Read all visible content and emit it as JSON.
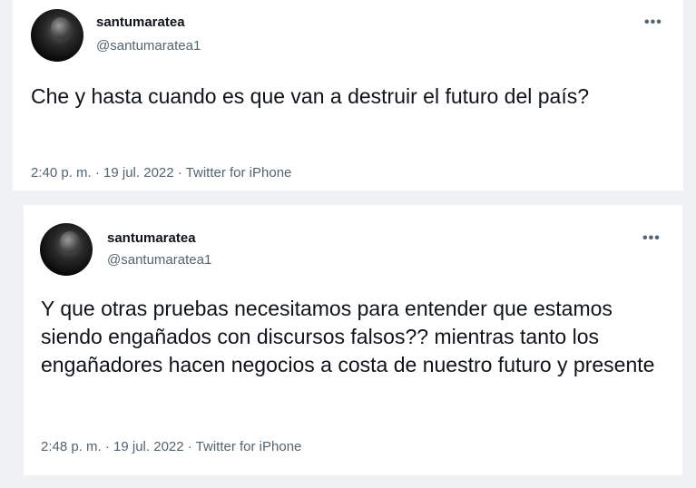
{
  "tweets": [
    {
      "display_name": "santumaratea",
      "handle": "@santumaratea1",
      "more": "•••",
      "text": "Che y hasta cuando es que van a destruir el futuro del país?",
      "meta": "2:40 p. m. · 19 jul. 2022 · Twitter for iPhone"
    },
    {
      "display_name": "santumaratea",
      "handle": "@santumaratea1",
      "more": "•••",
      "text": "Y que otras pruebas necesitamos para entender que estamos siendo engañados con discursos falsos?? mientras tanto los engañadores hacen negocios a costa de nuestro futuro y presente",
      "meta": "2:48 p. m. · 19 jul. 2022 · Twitter for iPhone"
    }
  ]
}
